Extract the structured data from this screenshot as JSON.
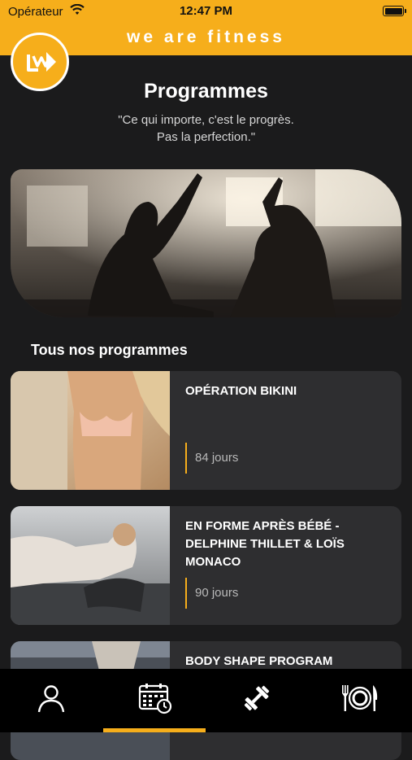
{
  "status_bar": {
    "carrier": "Opérateur",
    "time": "12:47 PM"
  },
  "header": {
    "brand": "we are fitness"
  },
  "page": {
    "title": "Programmes",
    "quote_line1": "\"Ce qui importe, c'est le progrès.",
    "quote_line2": "Pas la perfection.\""
  },
  "section": {
    "title": "Tous nos programmes"
  },
  "programs": [
    {
      "name": "OPÉRATION BIKINI",
      "days": "84 jours"
    },
    {
      "name": "EN FORME APRÈS BÉBÉ - DELPHINE THILLET & LOÏS MONACO",
      "days": "90 jours"
    },
    {
      "name": "BODY SHAPE PROGRAM",
      "days": ""
    }
  ],
  "tabs": [
    {
      "icon": "profile-icon",
      "active": false
    },
    {
      "icon": "calendar-icon",
      "active": true
    },
    {
      "icon": "dumbbell-icon",
      "active": false
    },
    {
      "icon": "plate-fork-knife-icon",
      "active": false
    }
  ],
  "colors": {
    "accent": "#f6ae1b",
    "background": "#1b1b1c",
    "card": "#2e2e30"
  }
}
